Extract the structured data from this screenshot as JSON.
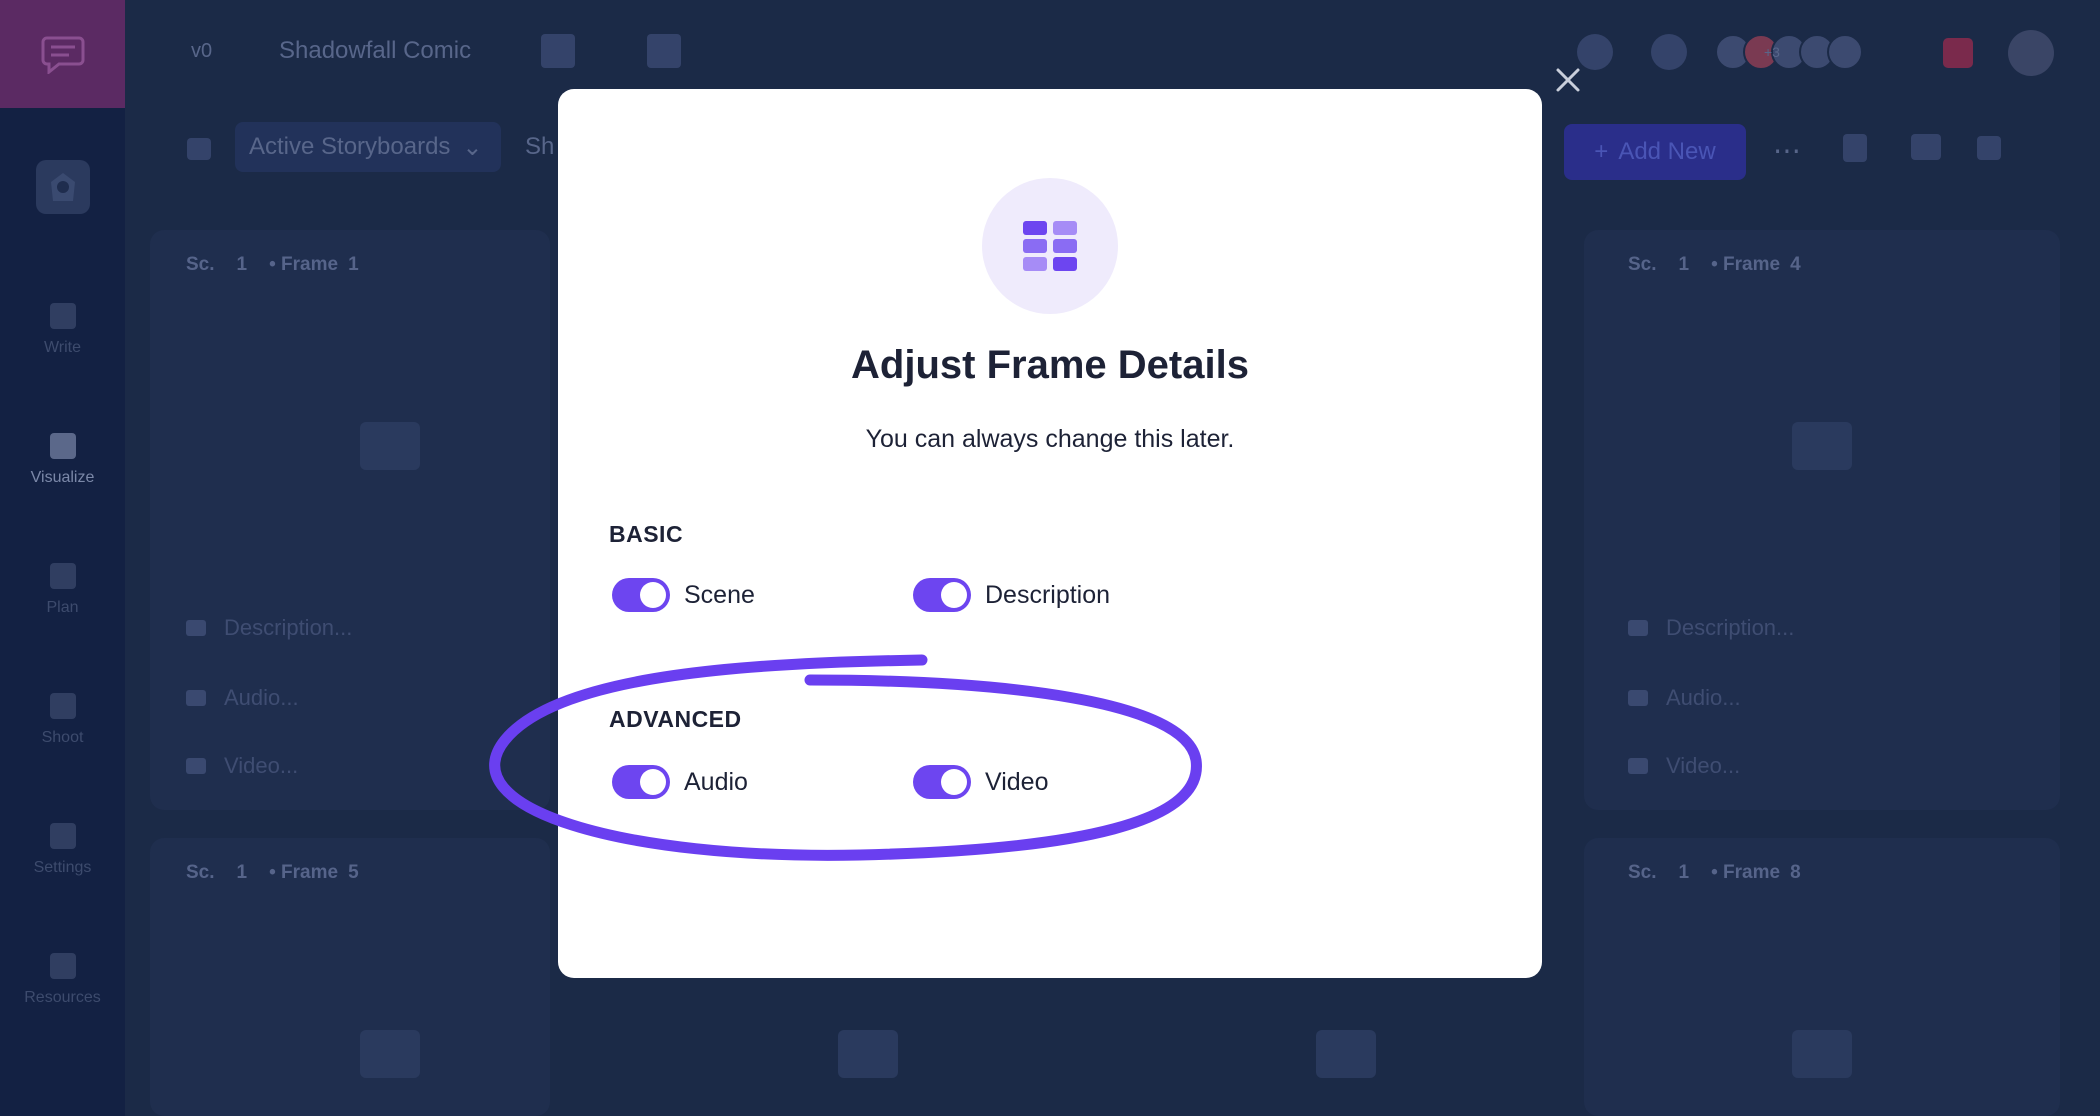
{
  "topbar": {
    "version": "v0",
    "project": "Shadowfall Comic",
    "more_collaborators": "+3"
  },
  "rail": {
    "items": [
      {
        "label": "Write"
      },
      {
        "label": "Visualize"
      },
      {
        "label": "Plan"
      },
      {
        "label": "Shoot"
      },
      {
        "label": "Settings"
      },
      {
        "label": "Resources"
      }
    ]
  },
  "toolbar": {
    "filter_label": "Active Storyboards",
    "filter_second": "Sh",
    "add_new": "Add New"
  },
  "frames": [
    {
      "scene_label": "Sc.",
      "scene": "1",
      "frame_label": "• Frame",
      "frame": "1",
      "description": "Description...",
      "audio": "Audio...",
      "video": "Video..."
    },
    {
      "scene_label": "Sc.",
      "scene": "1",
      "frame_label": "• Frame",
      "frame": "4",
      "description": "Description...",
      "audio": "Audio...",
      "video": "Video..."
    },
    {
      "scene_label": "Sc.",
      "scene": "1",
      "frame_label": "• Frame",
      "frame": "5"
    },
    {
      "scene_label": "Sc.",
      "scene": "1",
      "frame_label": "• Frame",
      "frame": "8"
    }
  ],
  "modal": {
    "title": "Adjust Frame Details",
    "subtitle": "You can always change this later.",
    "basic": {
      "heading": "BASIC",
      "toggles": [
        {
          "label": "Scene",
          "on": true
        },
        {
          "label": "Description",
          "on": true
        }
      ]
    },
    "advanced": {
      "heading": "ADVANCED",
      "toggles": [
        {
          "label": "Audio",
          "on": true
        },
        {
          "label": "Video",
          "on": true
        }
      ]
    }
  },
  "colors": {
    "accent": "#6d45f0",
    "annotation": "#6a3ff0",
    "overlay": "#1b2a47",
    "modal_bg": "#ffffff"
  }
}
